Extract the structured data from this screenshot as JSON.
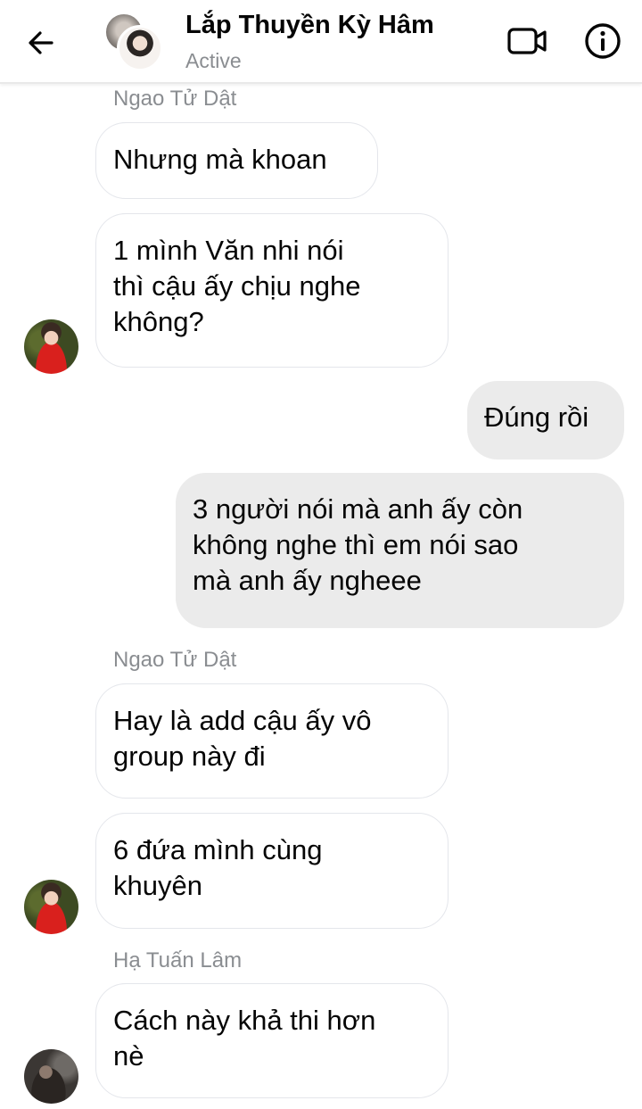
{
  "header": {
    "title": "Lắp Thuyền Kỳ Hâm",
    "status": "Active"
  },
  "icons": {
    "back": "arrow-left-icon",
    "video": "video-call-icon",
    "info": "info-icon"
  },
  "colors": {
    "incoming_bubble": "#ffffff",
    "incoming_border": "#e4e6eb",
    "outgoing_bubble": "#ebebeb",
    "sender_name": "#8a8d91"
  },
  "messages": [
    {
      "sender": "Ngao Tử Dật",
      "lines": [
        "Nhưng mà khoan"
      ]
    },
    {
      "lines": [
        "1 mình Văn nhi nói",
        "thì cậu ấy chịu nghe",
        "không?"
      ]
    },
    {
      "lines": [
        "Đúng rồi"
      ]
    },
    {
      "lines": [
        "3 người nói mà anh ấy còn",
        "không nghe thì em nói sao",
        "mà anh ấy ngheee"
      ]
    },
    {
      "sender": "Ngao Tử Dật",
      "lines": [
        "Hay là add cậu ấy vô",
        "group này đi"
      ]
    },
    {
      "lines": [
        "6 đứa mình cùng",
        "khuyên"
      ]
    },
    {
      "sender": "Hạ Tuấn Lâm",
      "lines": [
        "Cách này khả thi hơn",
        "nè"
      ]
    }
  ]
}
